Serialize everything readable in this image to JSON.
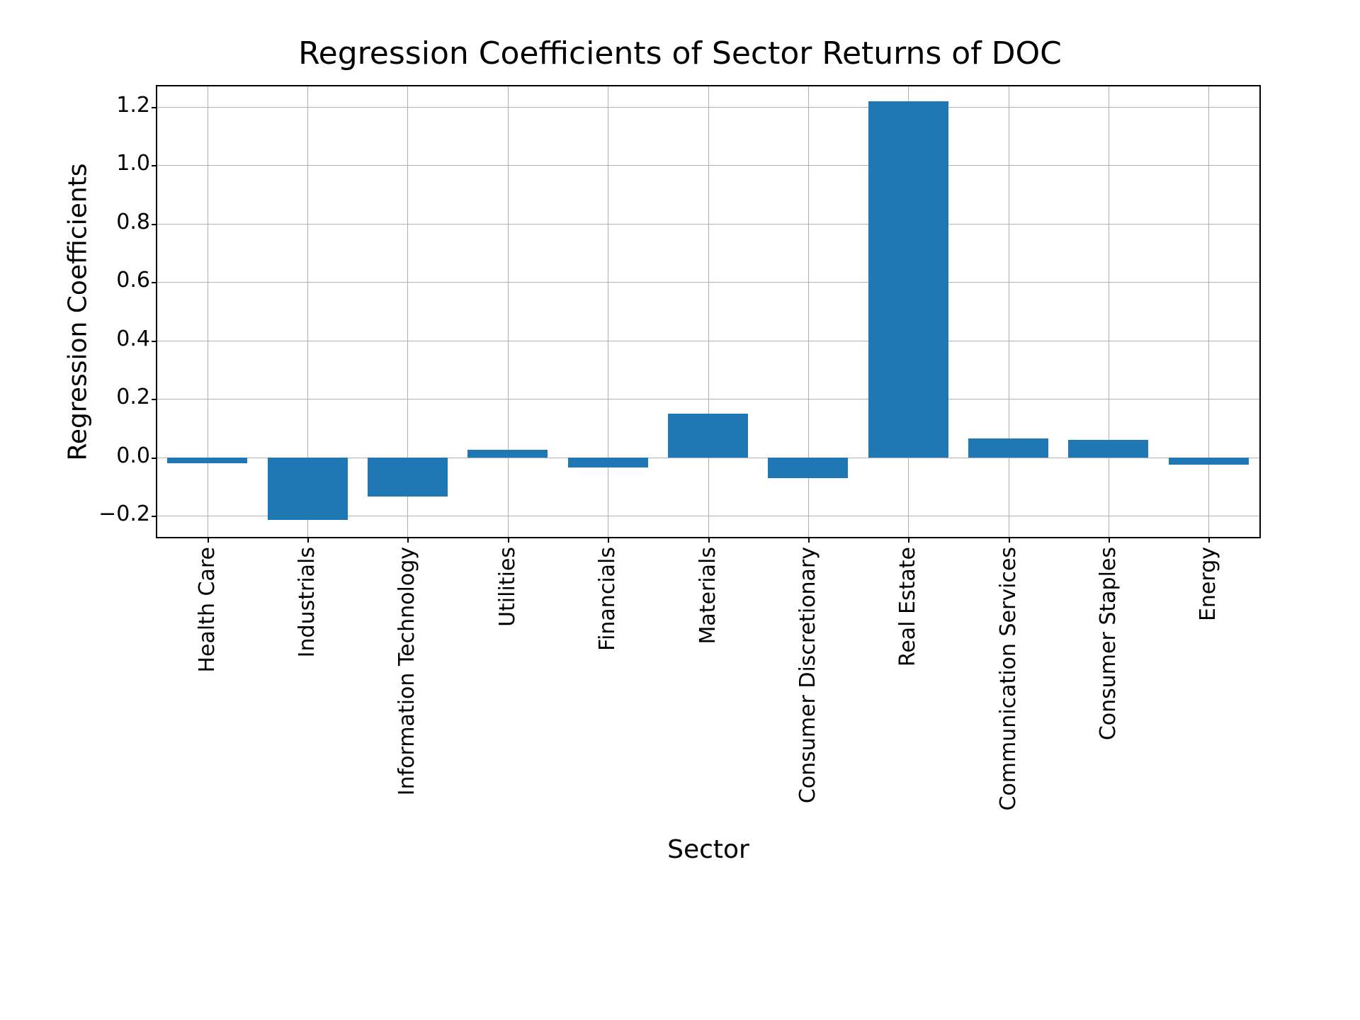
{
  "chart_data": {
    "type": "bar",
    "title": "Regression Coefficients of Sector Returns of DOC",
    "xlabel": "Sector",
    "ylabel": "Regression Coefficients",
    "ylim": [
      -0.27,
      1.27
    ],
    "yticks": [
      -0.2,
      0.0,
      0.2,
      0.4,
      0.6,
      0.8,
      1.0,
      1.2
    ],
    "ytick_labels": [
      "−0.2",
      "0.0",
      "0.2",
      "0.4",
      "0.6",
      "0.8",
      "1.0",
      "1.2"
    ],
    "categories": [
      "Health Care",
      "Industrials",
      "Information Technology",
      "Utilities",
      "Financials",
      "Materials",
      "Consumer Discretionary",
      "Real Estate",
      "Communication Services",
      "Consumer Staples",
      "Energy"
    ],
    "values": [
      -0.02,
      -0.215,
      -0.135,
      0.025,
      -0.035,
      0.15,
      -0.07,
      1.22,
      0.065,
      0.06,
      -0.025
    ],
    "bar_color": "#1f77b4",
    "grid": true
  }
}
